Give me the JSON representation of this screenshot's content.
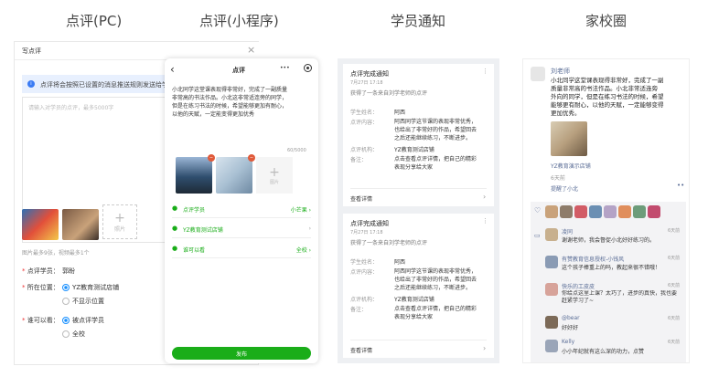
{
  "titles": {
    "pc": "点评(PC)",
    "mini": "点评(小程序)",
    "notify": "学员通知",
    "circle": "家校圈"
  },
  "pc": {
    "header": "写点评",
    "close": "×",
    "notice": "点评将会按照已设置的消息推送规则发送给学生",
    "placeholder": "请输入对学员的点评，最多5000字",
    "add_label": "照片",
    "hint": "图片最多9张，视频最多1个",
    "reviewee_label": "点评学员：",
    "reviewee_value": "郭盼",
    "location_label": "所在位置：",
    "location_opt1": "YZ教育测试店铺",
    "location_opt2": "不显示位置",
    "visible_label": "谁可以看：",
    "visible_opt1": "被点评学员",
    "visible_opt2": "全校"
  },
  "mini": {
    "title": "点评",
    "back": "‹",
    "more": "•••",
    "body": [
      "小北同学这堂课表现得非常好，完成了一副质量",
      "非常高的书法作品。小北这非常适连旁的同学，",
      "但是在练习书法的时候，希望能够更加有耐心，",
      "以他的天赋，一定能变得更加优秀"
    ],
    "counter": "60/5000",
    "add_label": "图片",
    "items": [
      {
        "label": "点评学员",
        "value": "小芒果 ›"
      },
      {
        "label": "YZ教育测试店铺",
        "value": "›"
      },
      {
        "label": "谁可以看",
        "value": "全校 ›"
      }
    ],
    "publish": "发布"
  },
  "notify": {
    "cards": [
      {
        "title": "点评完成通知",
        "date": "7月27日 17:18",
        "subtitle": "获得了一条来自刘学老师的点评",
        "rows": [
          {
            "k": "学生姓名：",
            "v": [
              "阿西"
            ]
          },
          {
            "k": "点评内容：",
            "v": [
              "阿西同学这节课的表现非常优秀，",
              "也给出了非常好的作品，希望回去",
              "之后还能继续练习，不断进步。"
            ]
          },
          {
            "k": "点评机构：",
            "v": [
              "YZ教育测试店铺"
            ]
          },
          {
            "k": "备注：",
            "v": [
              "点击查看点评详情，把自己的精彩",
              "表现分享给大家"
            ]
          }
        ],
        "link": "查看详情"
      },
      {
        "title": "点评完成通知",
        "date": "7月27日 17:18",
        "subtitle": "获得了一条来自刘学老师的点评",
        "rows": [
          {
            "k": "学生姓名：",
            "v": [
              "阿西"
            ]
          },
          {
            "k": "点评内容：",
            "v": [
              "阿西同学这节课的表现非常优秀，",
              "也给出了非常好的作品，希望回去",
              "之后还能继续练习，不断进步。"
            ]
          },
          {
            "k": "点评机构：",
            "v": [
              "YZ教育测试店铺"
            ]
          },
          {
            "k": "备注：",
            "v": [
              "点击查看点评详情，把自己的精彩",
              "表现分享给大家"
            ]
          }
        ],
        "link": "查看详情"
      }
    ]
  },
  "circle": {
    "author": "刘老师",
    "body": [
      "小北同学这堂课表现得非常好，完成了一副",
      "质量非常高的书法作品。小北非常适连旁",
      "外向的同学，但是在练习书法的时候，希望",
      "能够更有耐心，以他的天赋，一定能够变得",
      "更加优秀。"
    ],
    "shop": "YZ教育演示店铺",
    "time": "6天前",
    "remind": "提醒了小北",
    "comments": [
      {
        "name": "凌同",
        "text": "谢谢老师，我会督促小北好好练习的。",
        "time": "6天前"
      },
      {
        "name": "有赞教育信息授权-小钱风",
        "text": "这个孩子棒重上的吗，教起来很不错哦！",
        "time": "6天前"
      },
      {
        "name": "快乐的工皮皮",
        "text": "你给点这里上课？太巧了，进步的真快，我也要赶紧学习了~",
        "time": "6天前"
      },
      {
        "name": "@bear",
        "text": "好好好",
        "time": "6天前"
      },
      {
        "name": "Kelly",
        "text": "小小年纪就有这么深的功力，点赞",
        "time": "6天前"
      }
    ]
  }
}
